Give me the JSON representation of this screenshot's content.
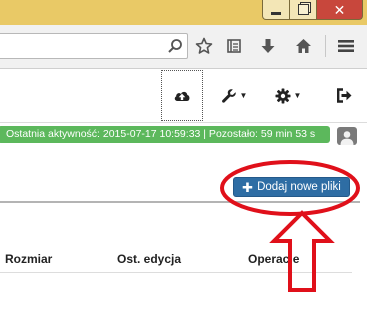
{
  "window": {
    "close_glyph": "✕"
  },
  "browser": {
    "icons": [
      "search-icon",
      "star-icon",
      "reading-list-icon",
      "download-icon",
      "home-icon",
      "menu-icon"
    ]
  },
  "nav": {
    "icons": [
      "cloud-upload-icon",
      "wrench-icon",
      "gear-icon",
      "logout-icon"
    ],
    "caret": "▼"
  },
  "session": {
    "status_text": "Ostatnia aktywność: 2015-07-17 10:59:33 | Pozostało: 59 min 53 s"
  },
  "files": {
    "add_button_label": "Dodaj nowe pliki",
    "add_button_plus": "✚",
    "columns": [
      "Rozmiar",
      "Ost. edycja",
      "Operacje"
    ]
  },
  "colors": {
    "status_green": "#5cb85c",
    "button_blue": "#2e6da4",
    "annotation_red": "#e0101a",
    "titlebar": "#e9c966"
  }
}
